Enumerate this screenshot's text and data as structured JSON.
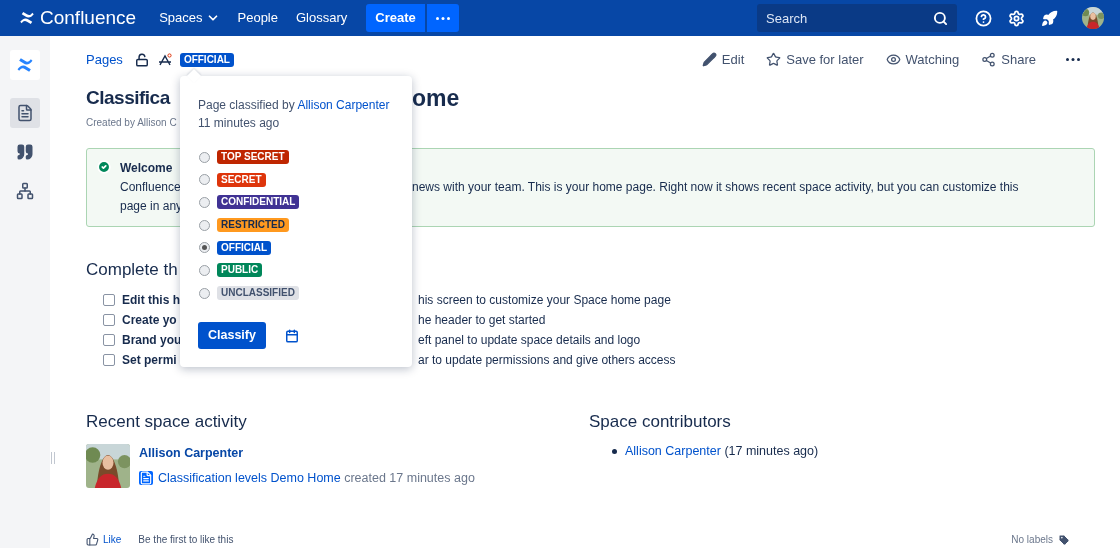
{
  "nav": {
    "logo": "Confluence",
    "items": [
      {
        "label": "Spaces",
        "kind": "dropdown"
      },
      {
        "label": "People",
        "kind": "link"
      },
      {
        "label": "Glossary",
        "kind": "link"
      }
    ],
    "create": "Create",
    "search": {
      "placeholder": "Search"
    }
  },
  "sidebar": {
    "items": [
      {
        "kind": "pages",
        "selected": true
      },
      {
        "kind": "quote",
        "selected": false
      },
      {
        "kind": "tree",
        "selected": false
      }
    ]
  },
  "breadcrumb": {
    "pages": "Pages",
    "classification": {
      "label": "OFFICIAL",
      "color": "#0052cc"
    }
  },
  "actions": [
    {
      "kind": "edit",
      "label": "Edit"
    },
    {
      "kind": "save",
      "label": "Save for later"
    },
    {
      "kind": "watch",
      "label": "Watching"
    },
    {
      "kind": "share",
      "label": "Share"
    },
    {
      "kind": "more"
    }
  ],
  "page": {
    "title": {
      "left": "Classifica",
      "right": "ome"
    },
    "byline": "Created by Allison C",
    "welcome": {
      "heading": "Welcome",
      "lines": [
        {
          "left": "Confluence",
          "right": "news with your team. This is your home page. Right now it shows recent space activity, but you can customize this"
        },
        {
          "left": "page in any"
        }
      ]
    },
    "checklist_heading": "Complete th",
    "checklist": [
      {
        "left": "Edit this h",
        "right": "his screen to customize your Space home page",
        "checked": false
      },
      {
        "left": "Create yo",
        "right": "he header to get started",
        "checked": false
      },
      {
        "left": "Brand you",
        "right": "eft panel to update space details and logo",
        "checked": false
      },
      {
        "left": "Set permi",
        "right": "ar to update permissions and give others access",
        "checked": false
      }
    ]
  },
  "recent": {
    "heading": "Recent space activity",
    "items": [
      {
        "user": "Allison Carpenter",
        "page": "Classification levels Demo Home",
        "action": "created 17 minutes ago"
      }
    ]
  },
  "contributors": {
    "heading": "Space contributors",
    "items": [
      {
        "name": "Allison Carpenter",
        "when": "(17 minutes ago)"
      }
    ]
  },
  "footer": {
    "like": "Like",
    "like_hint": "Be the first to like this",
    "labels": "No labels"
  },
  "popover": {
    "classified_by": "Page classified by",
    "user": "Allison Carpenter",
    "time": "11 minutes ago",
    "button": "Classify",
    "levels": [
      {
        "label": "TOP SECRET",
        "color": "#bf2600",
        "selected": false
      },
      {
        "label": "SECRET",
        "color": "#de350b",
        "selected": false
      },
      {
        "label": "CONFIDENTIAL",
        "color": "#403294",
        "selected": false
      },
      {
        "label": "RESTRICTED",
        "color": "#ff991f",
        "selected": false
      },
      {
        "label": "OFFICIAL",
        "color": "#0052cc",
        "selected": true
      },
      {
        "label": "PUBLIC",
        "color": "#00875a",
        "selected": false
      },
      {
        "label": "UNCLASSIFIED",
        "color": "#dfe1e6",
        "selected": false
      }
    ]
  }
}
